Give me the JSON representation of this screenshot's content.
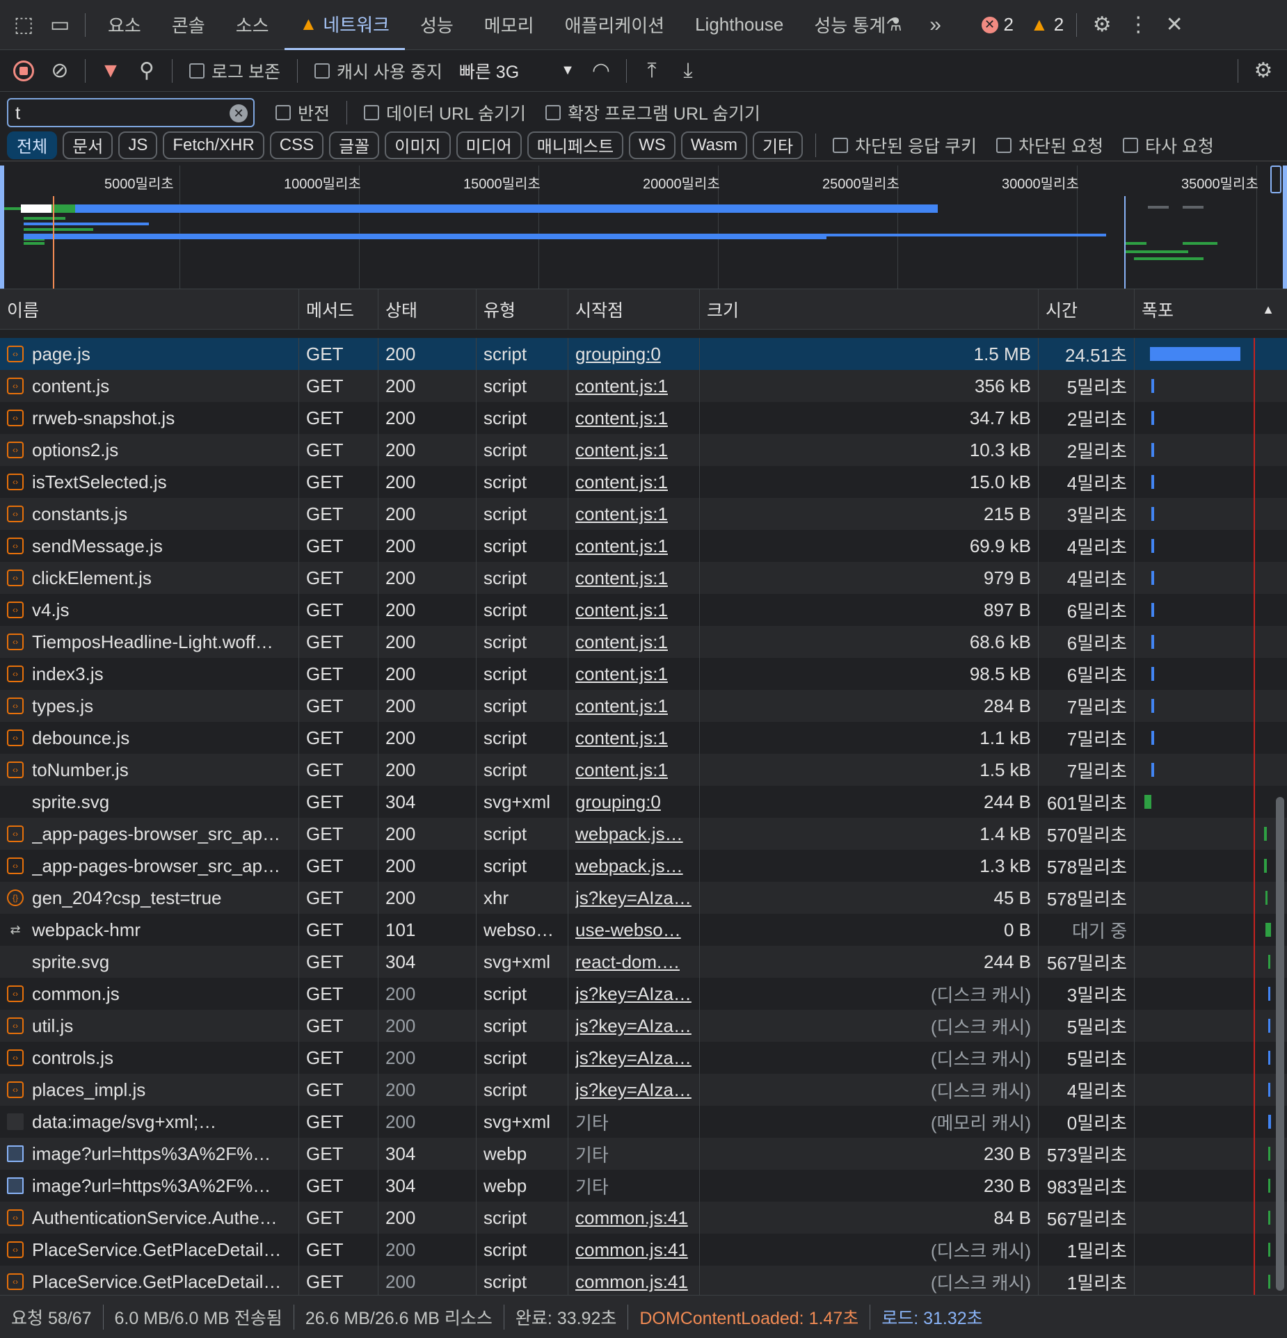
{
  "tabs": [
    "요소",
    "콘솔",
    "소스",
    "네트워크",
    "성능",
    "메모리",
    "애플리케이션",
    "Lighthouse",
    "성능 통계"
  ],
  "active_tab": "네트워크",
  "error_count": "2",
  "warning_count": "2",
  "toolbar": {
    "preserve_log": "로그 보존",
    "disable_cache": "캐시 사용 중지",
    "throttling": "빠른 3G"
  },
  "filter": {
    "value": "t",
    "invert": "반전",
    "hide_data_urls": "데이터 URL 숨기기",
    "hide_ext_urls": "확장 프로그램 URL 숨기기"
  },
  "types": [
    "전체",
    "문서",
    "JS",
    "Fetch/XHR",
    "CSS",
    "글꼴",
    "이미지",
    "미디어",
    "매니페스트",
    "WS",
    "Wasm",
    "기타"
  ],
  "blocked_cookies": "차단된 응답 쿠키",
  "blocked_requests": "차단된 요청",
  "third_party": "타사 요청",
  "ticks": [
    "5000밀리초",
    "10000밀리초",
    "15000밀리초",
    "20000밀리초",
    "25000밀리초",
    "30000밀리초",
    "35000밀리초"
  ],
  "columns": {
    "name": "이름",
    "method": "메서드",
    "status": "상태",
    "type": "유형",
    "initiator": "시작점",
    "size": "크기",
    "time": "시간",
    "waterfall": "폭포"
  },
  "rows": [
    {
      "name": "page.js",
      "method": "GET",
      "status": "200",
      "type": "script",
      "initiator": "grouping:0",
      "size": "1.5 MB",
      "time": "24.51초",
      "icon": "script"
    },
    {
      "name": "content.js",
      "method": "GET",
      "status": "200",
      "type": "script",
      "initiator": "content.js:1",
      "size": "356 kB",
      "time": "5밀리초",
      "icon": "script"
    },
    {
      "name": "rrweb-snapshot.js",
      "method": "GET",
      "status": "200",
      "type": "script",
      "initiator": "content.js:1",
      "size": "34.7 kB",
      "time": "2밀리초",
      "icon": "script"
    },
    {
      "name": "options2.js",
      "method": "GET",
      "status": "200",
      "type": "script",
      "initiator": "content.js:1",
      "size": "10.3 kB",
      "time": "2밀리초",
      "icon": "script"
    },
    {
      "name": "isTextSelected.js",
      "method": "GET",
      "status": "200",
      "type": "script",
      "initiator": "content.js:1",
      "size": "15.0 kB",
      "time": "4밀리초",
      "icon": "script"
    },
    {
      "name": "constants.js",
      "method": "GET",
      "status": "200",
      "type": "script",
      "initiator": "content.js:1",
      "size": "215 B",
      "time": "3밀리초",
      "icon": "script"
    },
    {
      "name": "sendMessage.js",
      "method": "GET",
      "status": "200",
      "type": "script",
      "initiator": "content.js:1",
      "size": "69.9 kB",
      "time": "4밀리초",
      "icon": "script"
    },
    {
      "name": "clickElement.js",
      "method": "GET",
      "status": "200",
      "type": "script",
      "initiator": "content.js:1",
      "size": "979 B",
      "time": "4밀리초",
      "icon": "script"
    },
    {
      "name": "v4.js",
      "method": "GET",
      "status": "200",
      "type": "script",
      "initiator": "content.js:1",
      "size": "897 B",
      "time": "6밀리초",
      "icon": "script"
    },
    {
      "name": "TiemposHeadline-Light.woff…",
      "method": "GET",
      "status": "200",
      "type": "script",
      "initiator": "content.js:1",
      "size": "68.6 kB",
      "time": "6밀리초",
      "icon": "script"
    },
    {
      "name": "index3.js",
      "method": "GET",
      "status": "200",
      "type": "script",
      "initiator": "content.js:1",
      "size": "98.5 kB",
      "time": "6밀리초",
      "icon": "script"
    },
    {
      "name": "types.js",
      "method": "GET",
      "status": "200",
      "type": "script",
      "initiator": "content.js:1",
      "size": "284 B",
      "time": "7밀리초",
      "icon": "script"
    },
    {
      "name": "debounce.js",
      "method": "GET",
      "status": "200",
      "type": "script",
      "initiator": "content.js:1",
      "size": "1.1 kB",
      "time": "7밀리초",
      "icon": "script"
    },
    {
      "name": "toNumber.js",
      "method": "GET",
      "status": "200",
      "type": "script",
      "initiator": "content.js:1",
      "size": "1.5 kB",
      "time": "7밀리초",
      "icon": "script"
    },
    {
      "name": "sprite.svg",
      "method": "GET",
      "status": "304",
      "type": "svg+xml",
      "initiator": "grouping:0",
      "size": "244 B",
      "time": "601밀리초",
      "icon": "none"
    },
    {
      "name": "_app-pages-browser_src_ap…",
      "method": "GET",
      "status": "200",
      "type": "script",
      "initiator": "webpack.js…",
      "size": "1.4 kB",
      "time": "570밀리초",
      "icon": "script"
    },
    {
      "name": "_app-pages-browser_src_ap…",
      "method": "GET",
      "status": "200",
      "type": "script",
      "initiator": "webpack.js…",
      "size": "1.3 kB",
      "time": "578밀리초",
      "icon": "script"
    },
    {
      "name": "gen_204?csp_test=true",
      "method": "GET",
      "status": "200",
      "type": "xhr",
      "initiator": "js?key=AIza…",
      "size": "45 B",
      "time": "578밀리초",
      "icon": "xhr"
    },
    {
      "name": "webpack-hmr",
      "method": "GET",
      "status": "101",
      "type": "webso…",
      "initiator": "use-webso…",
      "size": "0 B",
      "time": "대기 중",
      "icon": "ws"
    },
    {
      "name": "sprite.svg",
      "method": "GET",
      "status": "304",
      "type": "svg+xml",
      "initiator": "react-dom.…",
      "size": "244 B",
      "time": "567밀리초",
      "icon": "none"
    },
    {
      "name": "common.js",
      "method": "GET",
      "status": "200",
      "type": "script",
      "initiator": "js?key=AIza…",
      "size": "(디스크 캐시)",
      "time": "3밀리초",
      "icon": "script"
    },
    {
      "name": "util.js",
      "method": "GET",
      "status": "200",
      "type": "script",
      "initiator": "js?key=AIza…",
      "size": "(디스크 캐시)",
      "time": "5밀리초",
      "icon": "script"
    },
    {
      "name": "controls.js",
      "method": "GET",
      "status": "200",
      "type": "script",
      "initiator": "js?key=AIza…",
      "size": "(디스크 캐시)",
      "time": "5밀리초",
      "icon": "script"
    },
    {
      "name": "places_impl.js",
      "method": "GET",
      "status": "200",
      "type": "script",
      "initiator": "js?key=AIza…",
      "size": "(디스크 캐시)",
      "time": "4밀리초",
      "icon": "script"
    },
    {
      "name": "data:image/svg+xml;…",
      "method": "GET",
      "status": "200",
      "type": "svg+xml",
      "initiator": "기타",
      "size": "(메모리 캐시)",
      "time": "0밀리초",
      "icon": "data"
    },
    {
      "name": "image?url=https%3A%2F%…",
      "method": "GET",
      "status": "304",
      "type": "webp",
      "initiator": "기타",
      "size": "230 B",
      "time": "573밀리초",
      "icon": "img"
    },
    {
      "name": "image?url=https%3A%2F%…",
      "method": "GET",
      "status": "304",
      "type": "webp",
      "initiator": "기타",
      "size": "230 B",
      "time": "983밀리초",
      "icon": "img"
    },
    {
      "name": "AuthenticationService.Authe…",
      "method": "GET",
      "status": "200",
      "type": "script",
      "initiator": "common.js:41",
      "size": "84 B",
      "time": "567밀리초",
      "icon": "script"
    },
    {
      "name": "PlaceService.GetPlaceDetail…",
      "method": "GET",
      "status": "200",
      "type": "script",
      "initiator": "common.js:41",
      "size": "(디스크 캐시)",
      "time": "1밀리초",
      "icon": "script"
    },
    {
      "name": "PlaceService.GetPlaceDetail…",
      "method": "GET",
      "status": "200",
      "type": "script",
      "initiator": "common.js:41",
      "size": "(디스크 캐시)",
      "time": "1밀리초",
      "icon": "script"
    }
  ],
  "status_bar": {
    "requests": "요청 58/67",
    "transferred": "6.0 MB/6.0 MB 전송됨",
    "resources": "26.6 MB/26.6 MB 리소스",
    "finish": "완료: 33.92초",
    "dom_content_loaded": "DOMContentLoaded: 1.47초",
    "load": "로드: 31.32초"
  },
  "colors": {
    "accent": "#a8c7fa",
    "selected_row": "#0e3a5c",
    "dcl": "#f28b54",
    "load": "#8ab4f8",
    "record": "#f28b82",
    "filter_icon": "#f28b82"
  }
}
